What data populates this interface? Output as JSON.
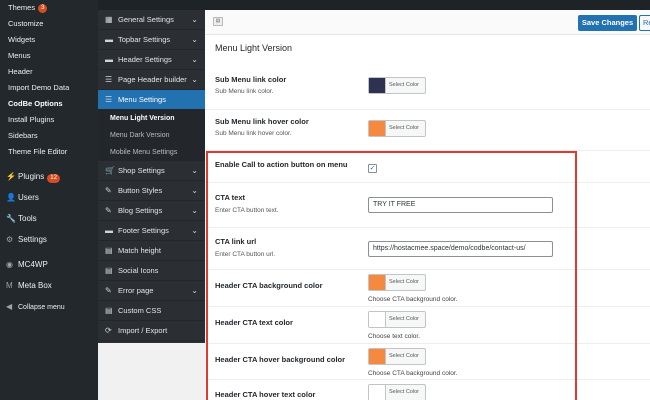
{
  "wp_sidebar": {
    "sub_items": [
      {
        "label": "Themes",
        "badge": "3"
      },
      {
        "label": "Customize"
      },
      {
        "label": "Widgets"
      },
      {
        "label": "Menus"
      },
      {
        "label": "Header"
      },
      {
        "label": "Import Demo Data"
      },
      {
        "label": "CodBe Options",
        "bold": true
      },
      {
        "label": "Install Plugins"
      },
      {
        "label": "Sidebars"
      },
      {
        "label": "Theme File Editor"
      }
    ],
    "top_items": [
      {
        "label": "Plugins",
        "badge": "12",
        "icon": "plug-icon",
        "glyph": "⚡"
      },
      {
        "label": "Users",
        "icon": "users-icon",
        "glyph": "👤"
      },
      {
        "label": "Tools",
        "icon": "tools-icon",
        "glyph": "🔧"
      },
      {
        "label": "Settings",
        "icon": "settings-icon",
        "glyph": "⚙"
      },
      {
        "label": "MC4WP",
        "icon": "mc4wp-icon",
        "glyph": "◉"
      },
      {
        "label": "Meta Box",
        "icon": "metabox-icon",
        "glyph": "M"
      },
      {
        "label": "Collapse menu",
        "icon": "collapse-icon",
        "glyph": "◀"
      }
    ]
  },
  "options_nav": {
    "items_before": [
      {
        "label": "General Settings",
        "icon": "general-settings-icon",
        "glyph": "▦",
        "chevron": true
      },
      {
        "label": "Topbar Settings",
        "icon": "topbar-icon",
        "glyph": "▬",
        "chevron": true
      },
      {
        "label": "Header Settings",
        "icon": "header-icon",
        "glyph": "▬",
        "chevron": true
      },
      {
        "label": "Page Header builder",
        "icon": "page-header-icon",
        "glyph": "☰",
        "chevron": true
      }
    ],
    "active": {
      "label": "Menu Settings",
      "icon": "menu-icon",
      "glyph": "☰"
    },
    "subs": [
      "Menu Light Version",
      "Menu Dark Version",
      "Mobile Menu Settings"
    ],
    "current_sub": 0,
    "items_after": [
      {
        "label": "Shop Settings",
        "icon": "shop-icon",
        "glyph": "🛒",
        "chevron": true
      },
      {
        "label": "Button Styles",
        "icon": "button-styles-icon",
        "glyph": "✎",
        "chevron": true
      },
      {
        "label": "Blog Settings",
        "icon": "blog-icon",
        "glyph": "✎",
        "chevron": true
      },
      {
        "label": "Footer Settings",
        "icon": "footer-icon",
        "glyph": "▬",
        "chevron": true
      },
      {
        "label": "Match height",
        "icon": "match-height-icon",
        "glyph": "▤",
        "chevron": false
      },
      {
        "label": "Social Icons",
        "icon": "social-icon",
        "glyph": "▤",
        "chevron": false
      },
      {
        "label": "Error page",
        "icon": "error-page-icon",
        "glyph": "✎",
        "chevron": true
      },
      {
        "label": "Custom CSS",
        "icon": "css-icon",
        "glyph": "▤",
        "chevron": false
      },
      {
        "label": "Import / Export",
        "icon": "import-export-icon",
        "glyph": "⟳",
        "chevron": false
      }
    ]
  },
  "toolbar": {
    "save_label": "Save Changes",
    "reset_label": "Re"
  },
  "section_title": "Menu Light Version",
  "fields": {
    "sub_link_color": {
      "label": "Sub Menu link color",
      "desc": "Sub Menu link color.",
      "color": "#2d3250",
      "btn": "Select Color"
    },
    "sub_link_hover": {
      "label": "Sub Menu link hover color",
      "desc": "Sub Menu link hover color.",
      "color": "#f5893d",
      "btn": "Select Color"
    },
    "enable_cta": {
      "label": "Enable Call to action button on menu",
      "checked": "✓"
    },
    "cta_text": {
      "label": "CTA text",
      "desc": "Enter CTA button text.",
      "value": "TRY IT FREE"
    },
    "cta_url": {
      "label": "CTA link url",
      "desc": "Enter CTA button url.",
      "value": "https://hostacmee.space/demo/codbe/contact-us/"
    },
    "cta_bg": {
      "label": "Header CTA background color",
      "desc": "Choose CTA background color.",
      "color": "#f5893d",
      "btn": "Select Color"
    },
    "cta_text_color": {
      "label": "Header CTA text color",
      "desc": "Choose text color.",
      "color": "#ffffff",
      "btn": "Select Color"
    },
    "cta_hover_bg": {
      "label": "Header CTA hover background color",
      "desc": "Choose CTA background color.",
      "color": "#f5893d",
      "btn": "Select Color"
    },
    "cta_hover_text": {
      "label": "Header CTA hover text color",
      "color": "#ffffff",
      "btn": "Select Color"
    }
  }
}
